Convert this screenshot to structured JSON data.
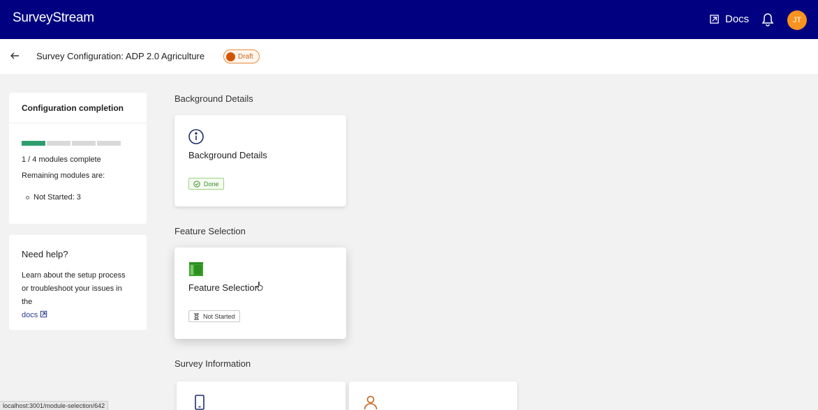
{
  "header": {
    "brand": "SurveyStream",
    "docs_label": "Docs",
    "avatar_initials": "JT",
    "color": "#000080",
    "avatar_color": "#f7931e"
  },
  "subheader": {
    "title": "Survey Configuration: ADP 2.0 Agriculture",
    "status_badge": "Draft"
  },
  "completion": {
    "title": "Configuration completion",
    "modules_complete": 1,
    "modules_total": 4,
    "modules_text": "1 / 4 modules complete",
    "remaining_label": "Remaining modules are:",
    "remaining_items": [
      "Not Started: 3"
    ]
  },
  "help": {
    "title": "Need help?",
    "text": "Learn about the setup process or troubleshoot your issues in the",
    "link": "docs"
  },
  "sections": [
    {
      "label": "Background Details",
      "cards": [
        {
          "title": "Background Details",
          "status": "Done",
          "icon": "info-icon"
        }
      ]
    },
    {
      "label": "Feature Selection",
      "cards": [
        {
          "title": "Feature Selection",
          "status": "Not Started",
          "icon": "layout-icon"
        }
      ]
    },
    {
      "label": "Survey Information",
      "cards": [
        {
          "icon": "mobile-icon"
        },
        {
          "icon": "user-icon"
        }
      ]
    }
  ],
  "browser_status_url": "localhost:3001/module-selection/642"
}
